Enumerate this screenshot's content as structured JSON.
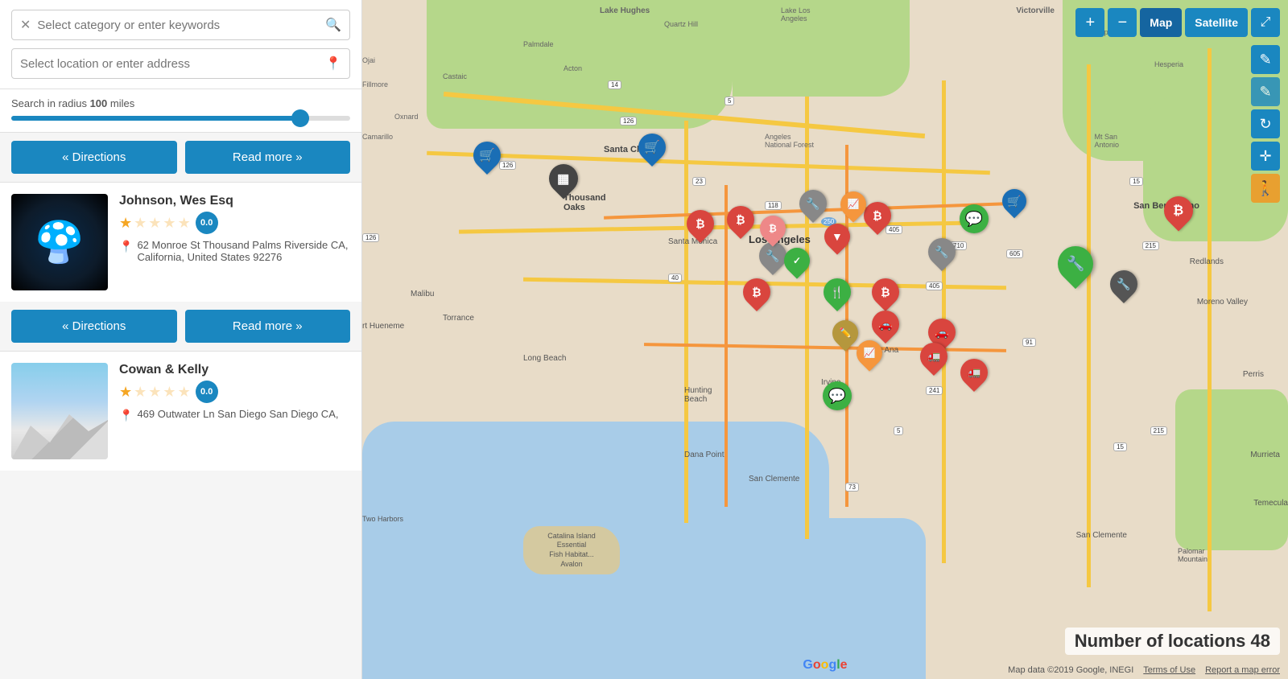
{
  "search": {
    "keyword_placeholder": "Select category or enter keywords",
    "location_placeholder": "Select location or enter address",
    "radius_label": "Search in radius",
    "radius_value": "100",
    "radius_unit": "miles"
  },
  "buttons": {
    "directions": "« Directions",
    "read_more": "Read more »"
  },
  "listings": [
    {
      "id": 1,
      "name": "Johnson, Wes Esq",
      "rating": "0.0",
      "address": "62 Monroe St Thousand Palms Riverside CA, California, United States 92276",
      "image_type": "mushroom"
    },
    {
      "id": 2,
      "name": "Cowan & Kelly",
      "rating": "0.0",
      "address": "469 Outwater Ln San Diego San Diego CA,",
      "image_type": "mountain"
    }
  ],
  "map": {
    "locations_count_label": "Number of locations",
    "locations_count": "48",
    "attribution": "Map data ©2019 Google, INEGI",
    "terms": "Terms of Use",
    "report": "Report a map error",
    "google_label": "Google"
  },
  "map_controls": {
    "zoom_in": "+",
    "zoom_out": "−",
    "map_label": "Map",
    "satellite_label": "Satellite",
    "fullscreen": "⛶",
    "edit_icon": "✎",
    "refresh_icon": "↻",
    "move_icon": "✛",
    "person_icon": "🚶"
  }
}
